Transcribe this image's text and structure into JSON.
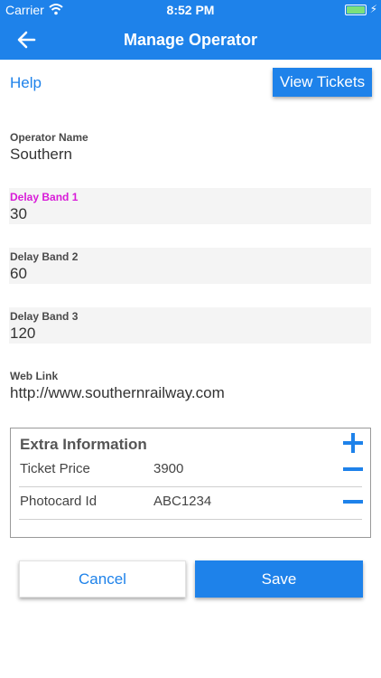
{
  "status_bar": {
    "carrier": "Carrier",
    "time": "8:52 PM",
    "wifi_icon": "wifi-icon",
    "battery_icon": "battery-icon",
    "charging_icon": "charging-bolt-icon"
  },
  "nav": {
    "title": "Manage Operator",
    "back_icon": "back-arrow-icon"
  },
  "toolbar": {
    "help_label": "Help",
    "view_tickets_label": "View Tickets"
  },
  "fields": {
    "operator_name": {
      "label": "Operator Name",
      "value": "Southern"
    },
    "delay_band_1": {
      "label": "Delay Band 1",
      "value": "30"
    },
    "delay_band_2": {
      "label": "Delay Band 2",
      "value": "60"
    },
    "delay_band_3": {
      "label": "Delay Band 3",
      "value": "120"
    },
    "web_link": {
      "label": "Web Link",
      "value": "http://www.southernrailway.com"
    }
  },
  "extra": {
    "heading": "Extra Information",
    "add_icon": "plus-icon",
    "rows": [
      {
        "key": "Ticket Price",
        "value": "3900",
        "remove_icon": "minus-icon"
      },
      {
        "key": "Photocard Id",
        "value": "ABC1234",
        "remove_icon": "minus-icon"
      }
    ]
  },
  "actions": {
    "cancel_label": "Cancel",
    "save_label": "Save"
  },
  "colors": {
    "primary": "#1e82ea",
    "active_label": "#d81bd8",
    "field_background": "#f4f4f4"
  }
}
